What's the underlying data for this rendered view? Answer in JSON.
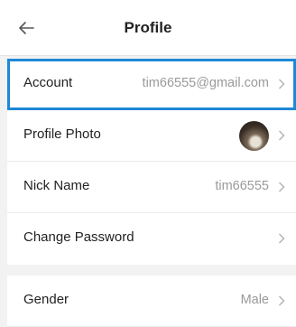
{
  "header": {
    "title": "Profile",
    "back_icon": "back-arrow-icon"
  },
  "rows": [
    {
      "label": "Account",
      "value": "tim66555@gmail.com",
      "selected": true
    },
    {
      "label": "Profile Photo",
      "value": "",
      "avatar": true
    },
    {
      "label": "Nick Name",
      "value": "tim66555"
    },
    {
      "label": "Change Password",
      "value": ""
    },
    {
      "label": "Gender",
      "value": "Male"
    }
  ],
  "colors": {
    "accent": "#1e88d8",
    "background": "#f2f2f2",
    "value_text": "#9a9a9a"
  }
}
